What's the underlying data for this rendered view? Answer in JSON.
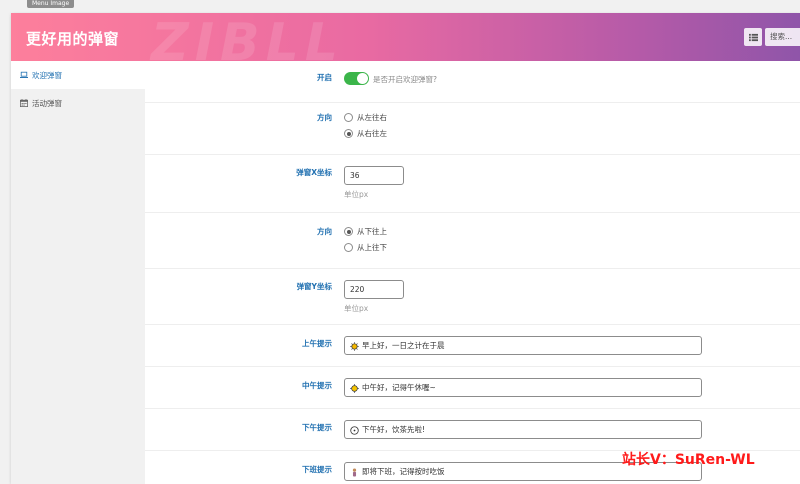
{
  "top_tag": "Menu Image",
  "header": {
    "title": "更好用的弹窗",
    "watermark": "ZIBLL",
    "search_label": "搜索..."
  },
  "sidebar": {
    "items": [
      {
        "label": "欢迎弹窗",
        "icon": "laptop-icon",
        "active": true
      },
      {
        "label": "活动弹窗",
        "icon": "calendar-icon",
        "active": false
      }
    ]
  },
  "fields": {
    "enable": {
      "label": "开启",
      "hint": "是否开启欢迎弹窗?",
      "value": true
    },
    "direction_x": {
      "label": "方向",
      "options": [
        "从左往右",
        "从右往左"
      ],
      "selected": 1
    },
    "pos_x": {
      "label": "弹窗X坐标",
      "value": "36",
      "unit": "单位px"
    },
    "direction_y": {
      "label": "方向",
      "options": [
        "从下往上",
        "从上往下"
      ],
      "selected": 0
    },
    "pos_y": {
      "label": "弹窗Y坐标",
      "value": "220",
      "unit": "单位px"
    },
    "morning": {
      "label": "上午提示",
      "value": "早上好，一日之计在于晨",
      "icon": "sun-rise-icon"
    },
    "noon": {
      "label": "中午提示",
      "value": "中午好，记得午休喔~",
      "icon": "sun-icon"
    },
    "afternoon": {
      "label": "下午提示",
      "value": "下午好，饮茶先啦!",
      "icon": "clock-icon"
    },
    "offwork": {
      "label": "下班提示",
      "value": "即将下班，记得按时吃饭",
      "icon": "person-icon"
    }
  },
  "footer_watermark": "站长V：SuRen-WL",
  "colors": {
    "accent": "#2271b1",
    "toggle_on": "#3bb54a",
    "header_start": "#fd7f9c",
    "header_end": "#8f55a9"
  }
}
